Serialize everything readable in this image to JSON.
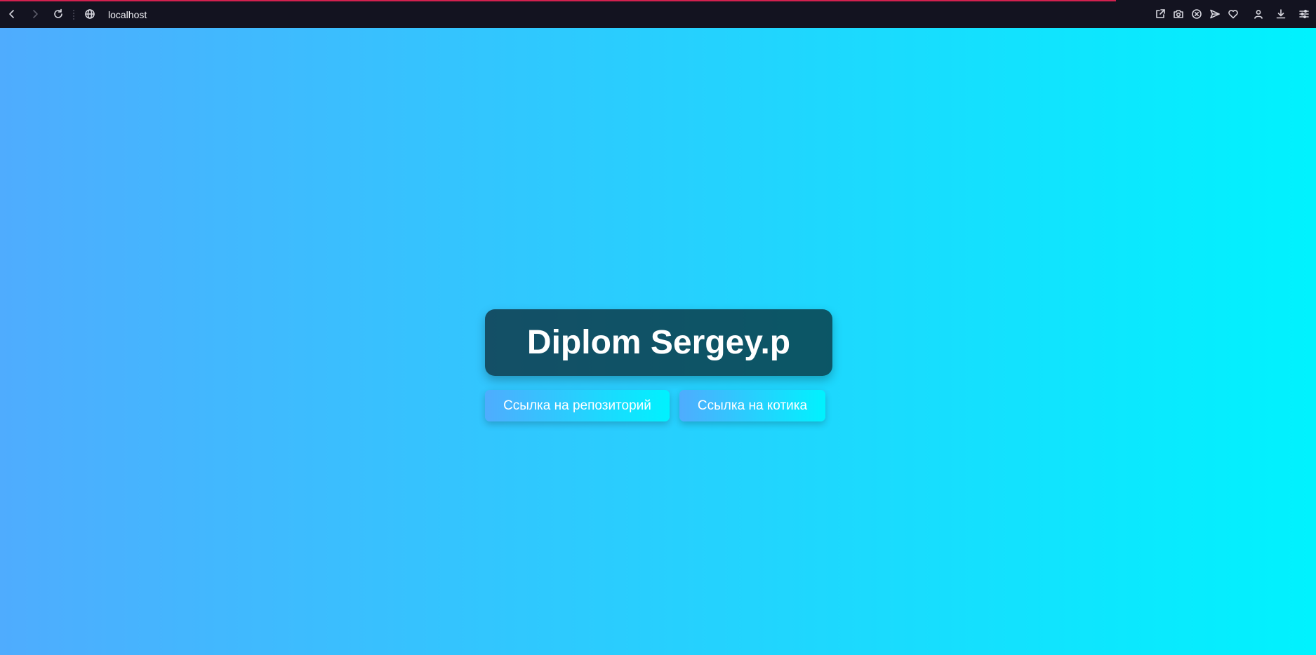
{
  "browser": {
    "url": "localhost",
    "icons": {
      "back": "back-arrow-icon",
      "forward": "forward-arrow-icon",
      "reload": "reload-icon",
      "site_info": "globe-icon",
      "share": "share-icon",
      "screenshot": "camera-icon",
      "block": "close-circle-icon",
      "send": "send-icon",
      "favorite": "heart-icon",
      "profile": "user-icon",
      "downloads": "download-icon",
      "menu": "settings-sliders-icon"
    },
    "colors": {
      "toolbar": "#131320",
      "loading_bar": "#d2214f"
    }
  },
  "page": {
    "title": "Diplom Sergey.p",
    "buttons": [
      {
        "label": "Ссылка на репозиторий"
      },
      {
        "label": "Ссылка на котика"
      }
    ],
    "colors": {
      "gradient_start": "#4facfe",
      "gradient_end": "#00f2fe",
      "card": "rgba(0,0,0,0.6)"
    }
  }
}
